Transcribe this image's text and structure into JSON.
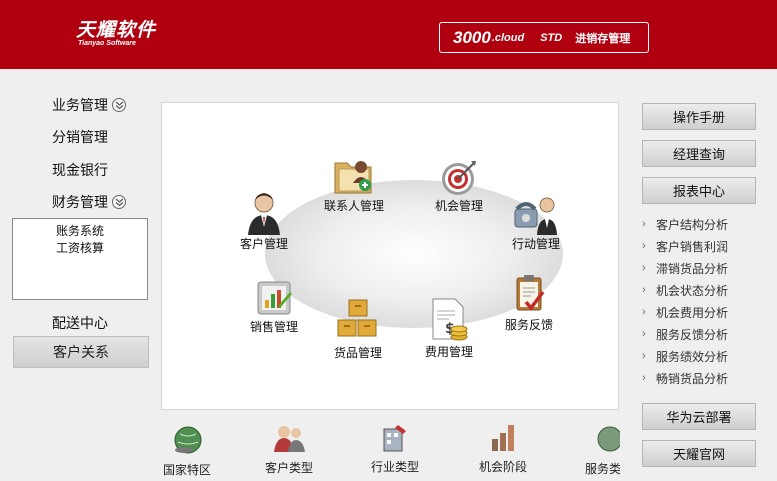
{
  "header": {
    "logo_cn": "天耀软件",
    "logo_en": "Tianyao Software",
    "product_number": "3000",
    "product_suffix": ".cloud",
    "edition": "STD",
    "product_name": "进销存管理"
  },
  "left_menu": {
    "items": [
      {
        "label": "业务管理",
        "expandable": true
      },
      {
        "label": "分销管理",
        "expandable": false
      },
      {
        "label": "现金银行",
        "expandable": false
      },
      {
        "label": "财务管理",
        "expandable": true
      }
    ],
    "finance_sub": [
      "账务系统",
      "工资核算"
    ],
    "delivery": "配送中心",
    "active": "客户关系"
  },
  "modules": {
    "contacts": "联系人管理",
    "opportunity": "机会管理",
    "customer": "客户管理",
    "action": "行动管理",
    "sales": "销售管理",
    "feedback": "服务反馈",
    "goods": "货品管理",
    "expense": "费用管理"
  },
  "bottom_modules": [
    "国家特区",
    "客户类型",
    "行业类型",
    "机会阶段",
    "服务类"
  ],
  "right_panel": {
    "manual": "操作手册",
    "manager_query": "经理查询",
    "report_center": "报表中心",
    "reports": [
      "客户结构分析",
      "客户销售利润",
      "滞销货品分析",
      "机会状态分析",
      "机会费用分析",
      "服务反馈分析",
      "服务绩效分析",
      "畅销货品分析"
    ],
    "huawei": "华为云部署",
    "official": "天耀官网"
  },
  "colors": {
    "header_red": "#b00010",
    "panel_bg": "#efefef"
  }
}
